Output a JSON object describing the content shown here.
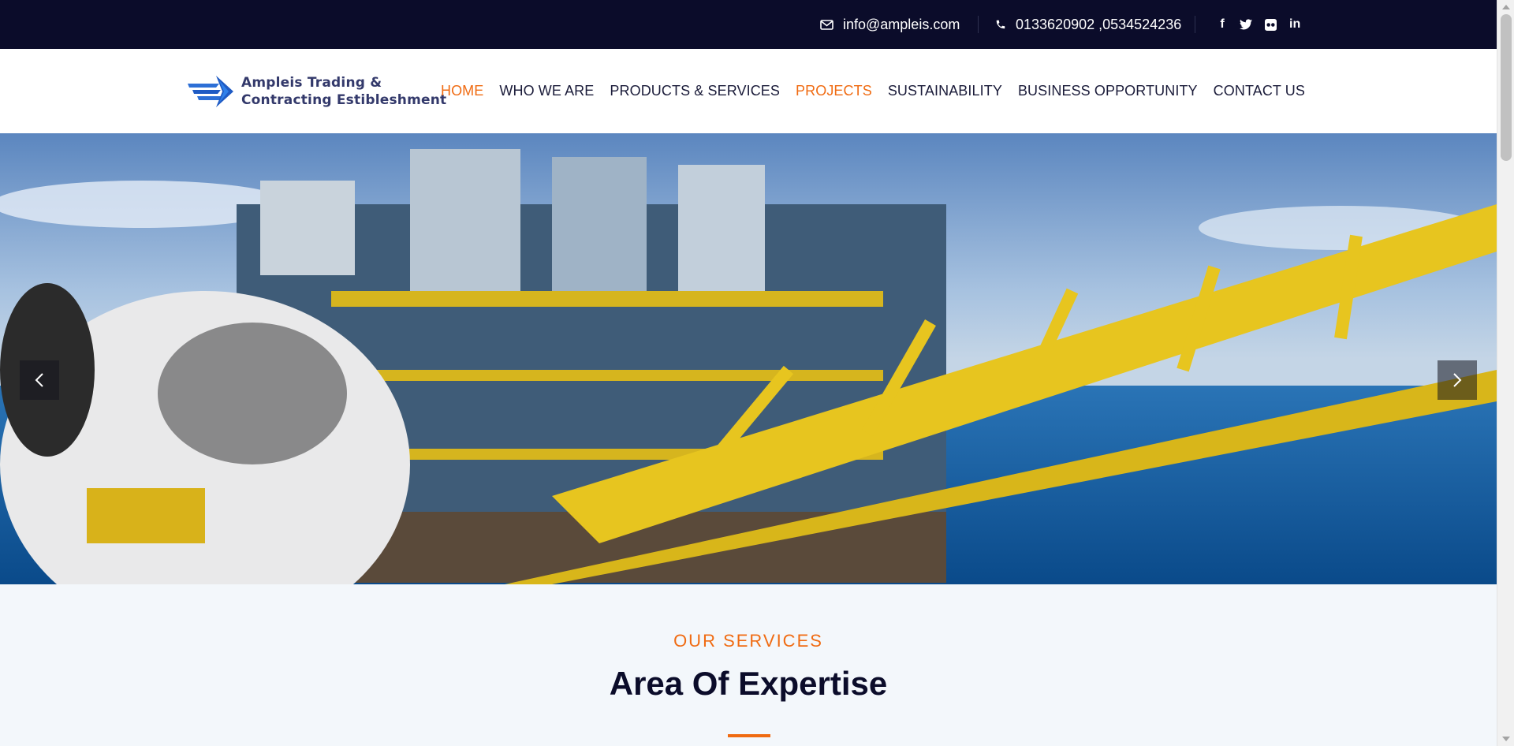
{
  "topbar": {
    "email": "info@ampleis.com",
    "phone": "0133620902 ,0534524236",
    "social": [
      "facebook-icon",
      "twitter-icon",
      "flickr-icon",
      "linkedin-icon"
    ],
    "social_glyphs": {
      "facebook": "f",
      "linkedin": "in"
    }
  },
  "header": {
    "logo_line1": "Ampleis  Trading  &",
    "logo_line2": "Contracting  Estibleshment",
    "nav": [
      "HOME",
      "WHO WE ARE",
      "PRODUCTS & SERVICES",
      "PROJECTS",
      "SUSTAINABILITY",
      "BUSINESS OPPORTUNITY",
      "CONTACT US"
    ],
    "active_nav": [
      "HOME",
      "PROJECTS"
    ]
  },
  "hero": {
    "image": "offshore-oil-platform-with-safety-helmet"
  },
  "services": {
    "eyebrow": "OUR SERVICES",
    "title": "Area Of Expertise"
  },
  "colors": {
    "dark_navy": "#0b0c2a",
    "accent_orange": "#f06b12",
    "logo_blue": "#33396b",
    "section_bg": "#f3f7fb"
  }
}
